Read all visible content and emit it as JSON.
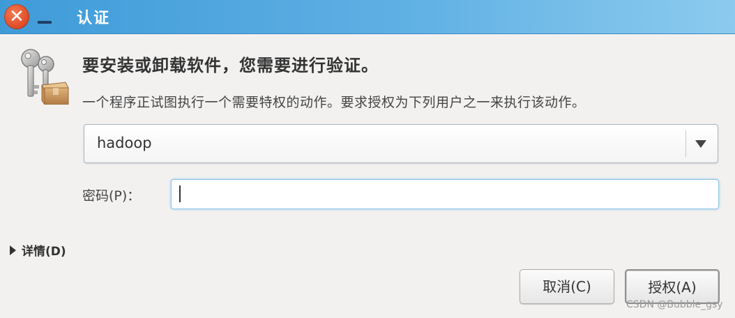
{
  "window": {
    "title": "认证",
    "close_icon": "close-icon",
    "minimize_icon": "minimize-icon"
  },
  "dialog": {
    "icon": "keys-package-icon",
    "heading": "要安装或卸载软件，您需要进行验证。",
    "message": "一个程序正试图执行一个需要特权的动作。要求授权为下列用户之一来执行该动作。",
    "user_select": {
      "selected": "hadoop",
      "icon": "chevron-down-icon"
    },
    "password": {
      "label": "密码(P)：",
      "value": "",
      "placeholder": ""
    },
    "details_label": "详情(D)",
    "buttons": {
      "cancel": "取消(C)",
      "authorize": "授权(A)"
    }
  },
  "watermark": "CSDN @Bubble_gsy",
  "colors": {
    "titlebar_start": "#3f9bd8",
    "titlebar_end": "#8ccbee",
    "close_button": "#e2502a",
    "focus_ring": "#8fc6ea",
    "background": "#f2f1f0"
  }
}
